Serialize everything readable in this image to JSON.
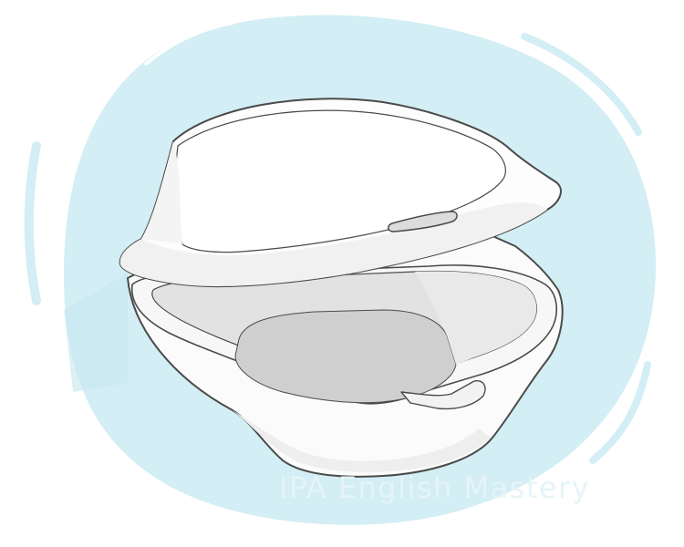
{
  "watermark": {
    "text": "IPA English Mastery"
  },
  "colors": {
    "background": "#ffffff",
    "blob": "#d3eef4",
    "blob_stroke": "#ffffff",
    "container_fill": "#fbfbfb",
    "container_shadow": "#e9e9e9",
    "container_inner": "#d6d6d6",
    "outline": "#4a4a4a",
    "watermark": "#e6f4f8"
  },
  "icons": [
    "background-blob-icon",
    "foam-food-container-icon"
  ]
}
